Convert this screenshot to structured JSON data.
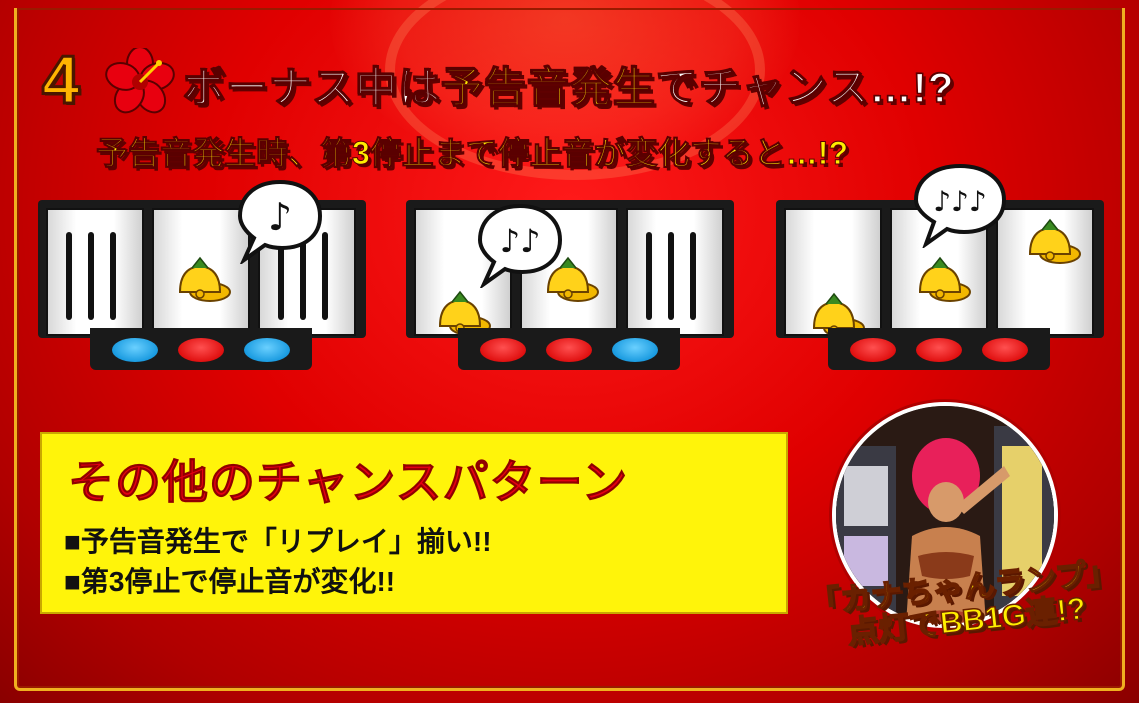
{
  "header": {
    "step_number": "4",
    "step_icon": "hibiscus-icon",
    "title_prefix": "ボーナス中は",
    "title_highlight": "予告音発生",
    "title_suffix": "でチャンス…!?",
    "subtitle": "予告音発生時、第3停止まで停止音が変化すると…!?"
  },
  "reels": [
    {
      "bubble_notes": "♪",
      "lamps": [
        "blue",
        "red",
        "blue"
      ],
      "reel_symbols": [
        "blur",
        "bell-icon",
        "blur"
      ]
    },
    {
      "bubble_notes": "♪♪",
      "lamps": [
        "red",
        "red",
        "blue"
      ],
      "reel_symbols": [
        "bell-icon",
        "bell-icon",
        "blur"
      ]
    },
    {
      "bubble_notes": "♪♪♪",
      "lamps": [
        "red",
        "red",
        "red"
      ],
      "reel_symbols": [
        "bell-icon",
        "bell-icon",
        "bell-icon"
      ]
    }
  ],
  "chance_panel": {
    "title": "その他のチャンスパターン",
    "items": [
      "■予告音発生で「リプレイ」揃い!!",
      "■第3停止で停止音が変化!!"
    ]
  },
  "kana_lamp": {
    "caption_line1": "「カナちゃんランプ」",
    "caption_line2": "点灯でBB1G連!?"
  },
  "colors": {
    "background_red": "#e00000",
    "highlight_yellow": "#ffee00",
    "panel_yellow": "#fff40a",
    "lamp_red": "#e01010",
    "lamp_blue": "#1a9be0",
    "gold_frame": "#f0b020"
  }
}
